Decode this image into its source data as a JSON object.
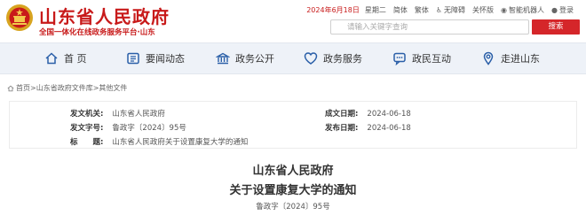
{
  "header": {
    "site_title": "山东省人民政府",
    "site_subtitle": "全国一体化在线政务服务平台·山东",
    "date": "2024年6月18日",
    "weekday": "星期二",
    "links": [
      "简体",
      "繁体",
      "无障碍",
      "关怀版",
      "智能机器人",
      "登录"
    ],
    "search_placeholder": "请输入关键字查询",
    "search_button": "搜索",
    "brand_color": "#c81a1a"
  },
  "nav": {
    "items": [
      {
        "label": "首 页",
        "icon": "home-icon"
      },
      {
        "label": "要闻动态",
        "icon": "news-icon"
      },
      {
        "label": "政务公开",
        "icon": "open-affairs-icon"
      },
      {
        "label": "政务服务",
        "icon": "service-icon"
      },
      {
        "label": "政民互动",
        "icon": "interaction-icon"
      },
      {
        "label": "走进山东",
        "icon": "map-pin-icon"
      }
    ]
  },
  "breadcrumb": {
    "items": [
      "首页",
      "山东省政府文件库",
      "其他文件"
    ],
    "separator": ">"
  },
  "meta": {
    "issuer_label": "发文机关:",
    "issuer_value": "山东省人民政府",
    "created_label": "成文日期:",
    "created_value": "2024-06-18",
    "docno_label": "发文字号:",
    "docno_value": "鲁政字〔2024〕95号",
    "published_label": "发布日期:",
    "published_value": "2024-06-18",
    "title_label": "标　　题:",
    "title_value": "山东省人民政府关于设置康复大学的通知"
  },
  "document": {
    "title_line1": "山东省人民政府",
    "title_line2": "关于设置康复大学的通知",
    "number": "鲁政字〔2024〕95号"
  }
}
